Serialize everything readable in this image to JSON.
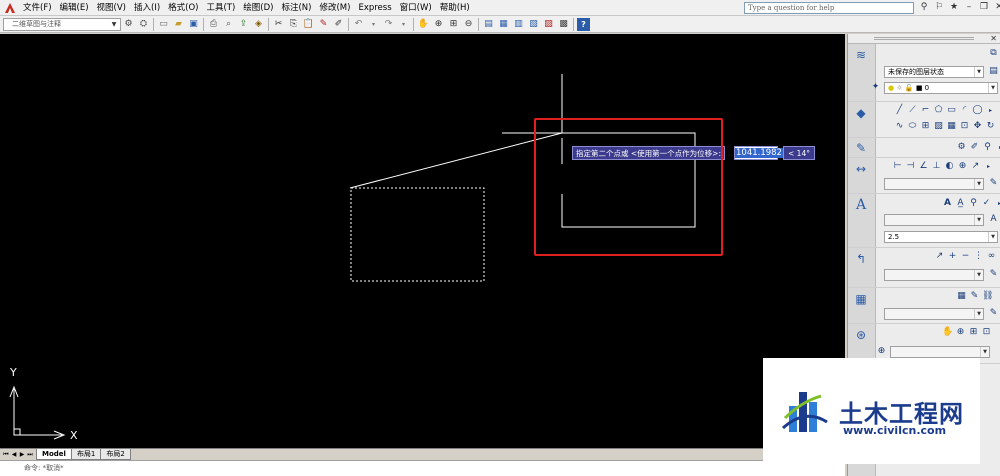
{
  "menubar": {
    "items": [
      "文件(F)",
      "编辑(E)",
      "视图(V)",
      "插入(I)",
      "格式(O)",
      "工具(T)",
      "绘图(D)",
      "标注(N)",
      "修改(M)",
      "Express",
      "窗口(W)",
      "帮助(H)"
    ],
    "help_placeholder": "Type a question for help"
  },
  "toolbar": {
    "workspace": "二维草图与注释"
  },
  "prompt": {
    "text": "指定第二个点或 <使用第一个点作为位移>:",
    "value": "1041.1982",
    "angle": "< 14°"
  },
  "ucs": {
    "y_label": "Y",
    "x_label": "X"
  },
  "layout_tabs": [
    "Model",
    "布局1",
    "布局2"
  ],
  "command_line": "命令: *取消*",
  "palette": {
    "layer_state": "未保存的图层状态",
    "layer_current": "0",
    "text_height": "2.5"
  },
  "watermark": {
    "title": "土木工程网",
    "url": "www.civilcn.com"
  },
  "colors": {
    "canvas_bg": "#000000",
    "highlight_border": "#e02020",
    "prompt_bg": "#3b3a8c",
    "watermark_blue": "#1b3b8c"
  }
}
